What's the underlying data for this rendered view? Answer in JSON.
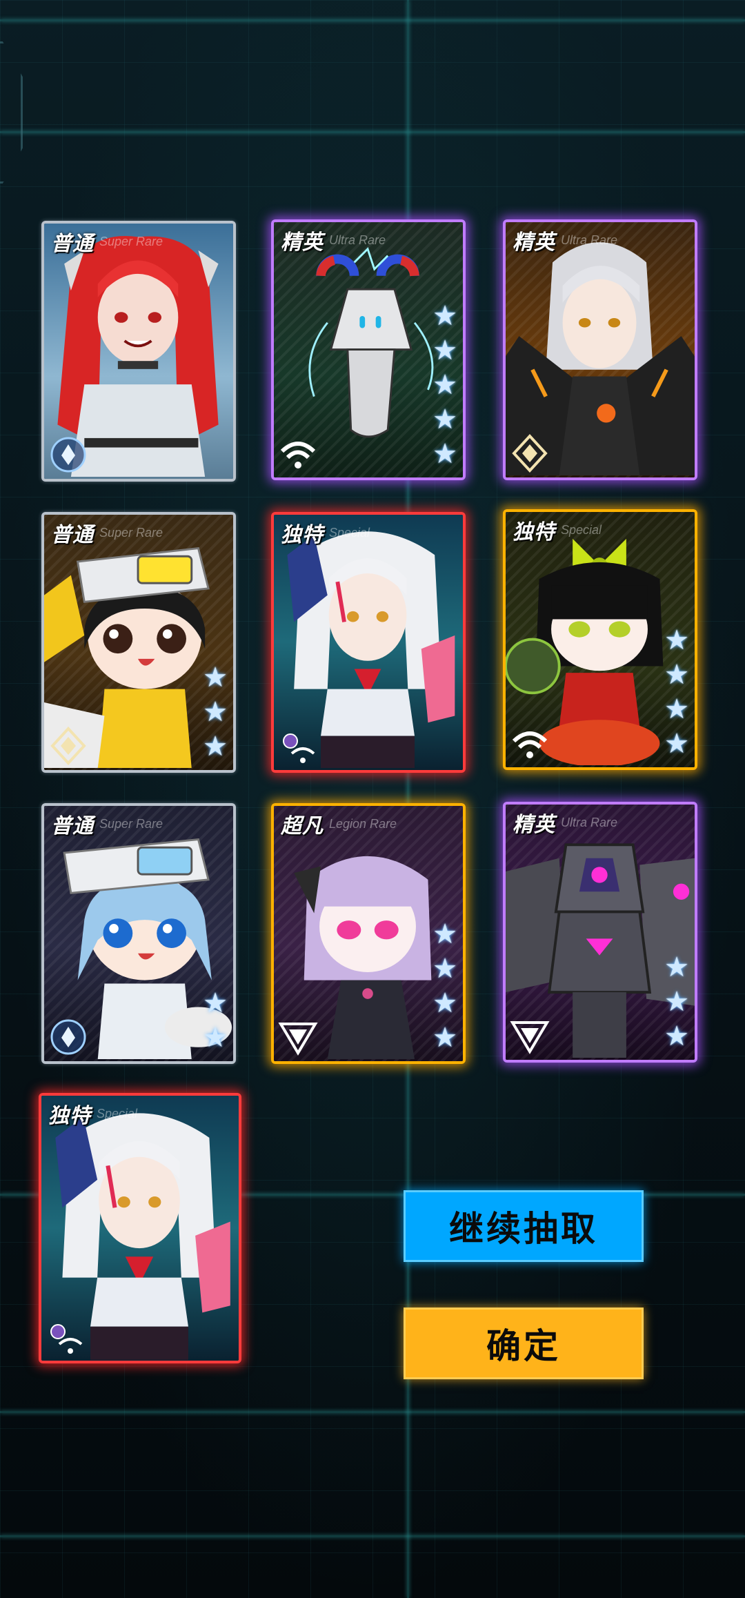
{
  "cards": [
    {
      "rarity": "普通",
      "subtitle": "Super Rare",
      "stars": 0,
      "class_icon": "drop-icon",
      "portrait": "red-twin-tails-girl"
    },
    {
      "rarity": "精英",
      "subtitle": "Ultra Rare",
      "stars": 5,
      "class_icon": "signal-icon",
      "portrait": "magnet-robot"
    },
    {
      "rarity": "精英",
      "subtitle": "Ultra Rare",
      "stars": 0,
      "class_icon": "diamond-icon",
      "portrait": "silver-hair-girl"
    },
    {
      "rarity": "普通",
      "subtitle": "Super Rare",
      "stars": 3,
      "class_icon": "diamond-icon",
      "portrait": "chibi-yellow-cap"
    },
    {
      "rarity": "独特",
      "subtitle": "Special",
      "stars": 0,
      "class_icon": "signal-icon",
      "portrait": "white-hair-girl"
    },
    {
      "rarity": "独特",
      "subtitle": "Special",
      "stars": 4,
      "class_icon": "signal-icon",
      "portrait": "chibi-green-bow"
    },
    {
      "rarity": "普通",
      "subtitle": "Super Rare",
      "stars": 2,
      "class_icon": "drop-icon",
      "portrait": "chibi-blue-cap"
    },
    {
      "rarity": "超凡",
      "subtitle": "Legion Rare",
      "stars": 4,
      "class_icon": "triangle-icon",
      "portrait": "chibi-lilac-hair"
    },
    {
      "rarity": "精英",
      "subtitle": "Ultra Rare",
      "stars": 3,
      "class_icon": "triangle-icon",
      "portrait": "purple-mech"
    },
    {
      "rarity": "独特",
      "subtitle": "Special",
      "stars": 0,
      "class_icon": "signal-icon",
      "portrait": "white-hair-girl"
    }
  ],
  "buttons": {
    "continue_label": "继续抽取",
    "confirm_label": "确定"
  }
}
